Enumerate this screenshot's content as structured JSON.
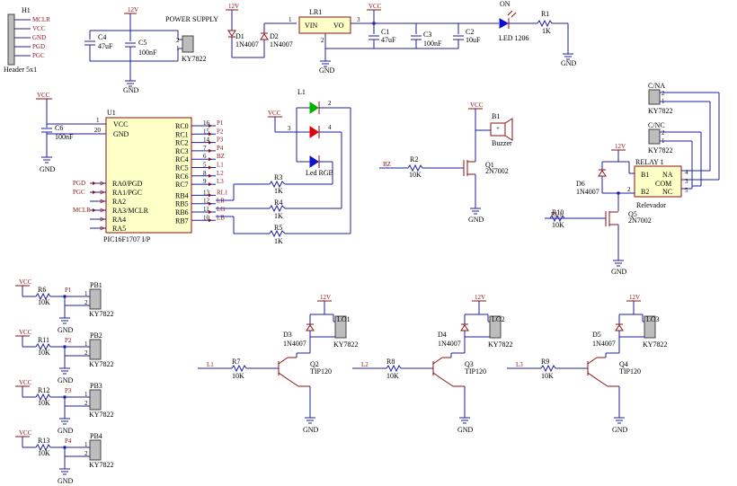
{
  "header": {
    "ref": "H1",
    "value": "Header 5x1",
    "pins": [
      "MCLR",
      "VCC",
      "GND",
      "PGD",
      "PGC"
    ]
  },
  "power": {
    "title": "POWER SUPPLY",
    "c4": "C4",
    "c4v": "47uF",
    "c5": "C5",
    "c5v": "100nF",
    "conn": "KY7822",
    "d1": "D1",
    "d1v": "1N4007",
    "d2": "D2",
    "d2v": "1N4007",
    "lr": "LR1",
    "vin": "VIN",
    "vo": "VO",
    "c1": "C1",
    "c1v": "47uF",
    "c3": "C3",
    "c3v": "100nF",
    "c2": "C2",
    "c2v": "10uF",
    "led": "LED 1206",
    "ledon": "ON",
    "r1": "R1",
    "r1v": "1K"
  },
  "nets": {
    "vcc": "VCC",
    "gnd": "GND",
    "v12": "12V"
  },
  "mcu": {
    "ref": "U1",
    "value": "PIC16F1707 I/P",
    "vcc": "VCC",
    "gnd": "GND",
    "left": [
      "RA0/PGD",
      "RA1/PGC",
      "RA2",
      "RA3/MCLR",
      "RA4",
      "RA5"
    ],
    "right": [
      "RC0",
      "RC1",
      "RC2",
      "RC3",
      "RC4",
      "RC5",
      "RC6",
      "RC7",
      "RB4",
      "RB5",
      "RB6",
      "RB7"
    ],
    "rightnums": [
      "16",
      "15",
      "14",
      "7",
      "6",
      "5",
      "8",
      "9",
      "13",
      "12",
      "11",
      "10"
    ],
    "rightnets": [
      "P1",
      "P2",
      "P3",
      "P4",
      "BZ",
      "L1",
      "L2",
      "L3",
      "RL1",
      "LR",
      "LG",
      "LB"
    ],
    "leftnets": [
      "PGD",
      "PGC",
      "",
      "MCLR",
      "",
      ""
    ],
    "c6": "C6",
    "c6v": "100nF"
  },
  "rgb": {
    "ref": "L1",
    "value": "Led RGB",
    "r3": "R3",
    "r4": "R4",
    "r5": "R5",
    "rv": "1K"
  },
  "buzzer": {
    "ref": "B1",
    "value": "Buzzer",
    "r2": "R2",
    "r2v": "10K",
    "q": "Q1",
    "qv": "2N7002",
    "net": "BZ"
  },
  "relay": {
    "cna": "C/NA",
    "cnc": "C/NC",
    "conn": "KY7822",
    "ref": "RELAY 1",
    "value": "Relevador",
    "b1": "B1",
    "b2": "B2",
    "na": "NA",
    "com": "COM",
    "nc": "NC",
    "d6": "D6",
    "d6v": "1N4007",
    "r10": "R10",
    "r10v": "10K",
    "q5": "Q5",
    "q5v": "2N7002",
    "net": "RL1"
  },
  "buttons": [
    {
      "r": "R6",
      "p": "P1",
      "pb": "PB1"
    },
    {
      "r": "R11",
      "p": "P2",
      "pb": "PB2"
    },
    {
      "r": "R12",
      "p": "P3",
      "pb": "PB3"
    },
    {
      "r": "R13",
      "p": "P4",
      "pb": "PB4"
    }
  ],
  "loads": [
    {
      "d": "D3",
      "lo": "LO1",
      "r": "R7",
      "q": "Q2",
      "net": "L1"
    },
    {
      "d": "D4",
      "lo": "LO2",
      "r": "R8",
      "q": "Q3",
      "net": "L2"
    },
    {
      "d": "D5",
      "lo": "LO3",
      "r": "R9",
      "q": "Q4",
      "net": "L3"
    }
  ],
  "common": {
    "rv": "10K",
    "dv": "1N4007",
    "conn": "KY7822",
    "qv": "TIP120"
  }
}
